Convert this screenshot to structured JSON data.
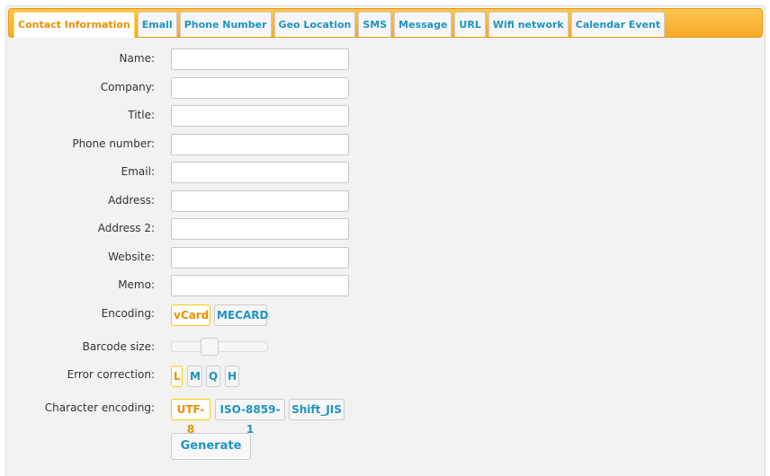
{
  "tabs": [
    {
      "label": "Contact Information",
      "active": true
    },
    {
      "label": "Email"
    },
    {
      "label": "Phone Number"
    },
    {
      "label": "Geo Location"
    },
    {
      "label": "SMS"
    },
    {
      "label": "Message"
    },
    {
      "label": "URL"
    },
    {
      "label": "Wifi network"
    },
    {
      "label": "Calendar Event"
    }
  ],
  "form": {
    "fields": [
      {
        "label": "Name:",
        "value": ""
      },
      {
        "label": "Company:",
        "value": ""
      },
      {
        "label": "Title:",
        "value": ""
      },
      {
        "label": "Phone number:",
        "value": ""
      },
      {
        "label": "Email:",
        "value": ""
      },
      {
        "label": "Address:",
        "value": ""
      },
      {
        "label": "Address 2:",
        "value": ""
      },
      {
        "label": "Website:",
        "value": ""
      },
      {
        "label": "Memo:",
        "value": ""
      }
    ],
    "encoding": {
      "label": "Encoding:",
      "options": [
        "vCard",
        "MECARD"
      ],
      "selected": "vCard"
    },
    "barcode_size": {
      "label": "Barcode size:",
      "value_fraction": 0.38
    },
    "error_correction": {
      "label": "Error correction:",
      "options": [
        "L",
        "M",
        "Q",
        "H"
      ],
      "selected": "L"
    },
    "character_encoding": {
      "label": "Character encoding:",
      "options": [
        "UTF-8",
        "ISO-8859-1",
        "Shift_JIS"
      ],
      "selected": "UTF-8"
    },
    "generate_label": "Generate"
  },
  "colors": {
    "tab_bar": "#f7a928",
    "accent_selected": "#eb8f00",
    "link_blue": "#1c94c4"
  }
}
